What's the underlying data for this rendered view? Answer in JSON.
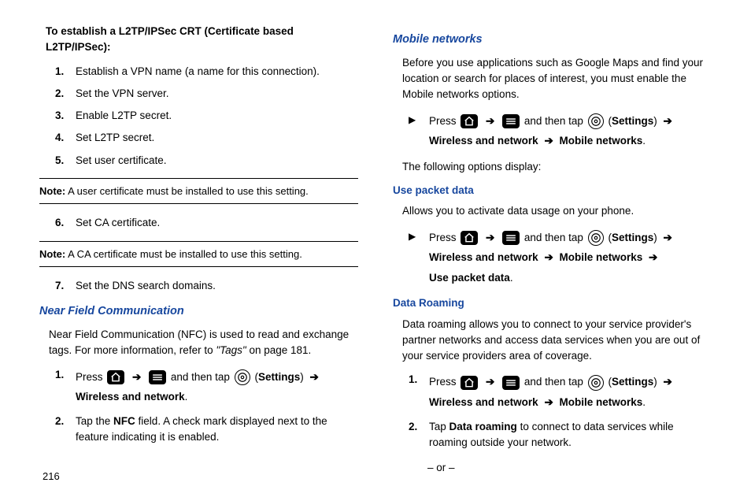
{
  "pageNumber": "216",
  "arrow": "➔",
  "settingsLabel": "Settings",
  "left": {
    "heading": "To establish a L2TP/IPSec CRT (Certificate based L2TP/IPSec):",
    "steps1": [
      "Establish a VPN name (a name for this connection).",
      "Set the VPN server.",
      "Enable L2TP secret.",
      "Set L2TP secret.",
      "Set user certificate."
    ],
    "note1Label": "Note:",
    "note1": " A user certificate must be installed to use this setting.",
    "step6num": "6.",
    "step6": "Set CA certificate.",
    "note2Label": "Note:",
    "note2": " A CA certificate must be installed to use this setting.",
    "step7num": "7.",
    "step7": "Set the DNS search domains.",
    "nfc": {
      "title": "Near Field Communication",
      "intro1": "Near Field Communication (NFC) is used to read and exchange tags. For more information, refer to ",
      "introItal": "\"Tags\"",
      "intro2": "  on page 181.",
      "step1a": "Press ",
      "step1b": " and then tap ",
      "step1c": " (",
      "step1d": ") ",
      "wn": "Wireless and network",
      "period": ".",
      "num1": "1.",
      "num2": "2.",
      "step2a": "Tap the ",
      "step2bold": "NFC",
      "step2b": " field. A check mark displayed next to the feature indicating it is enabled."
    }
  },
  "right": {
    "mn": {
      "title": "Mobile networks",
      "intro": "Before you use applications such as Google Maps and find your location or search for places of interest, you must enable the Mobile networks options.",
      "pressPrefix": "Press ",
      "andThenTap": " and then tap ",
      "openParen": " (",
      "closeParen": ") ",
      "wn": "Wireless and network",
      "mnLabel": "Mobile networks",
      "period": ".",
      "followOpts": "The following options display:"
    },
    "upd": {
      "title": "Use packet data",
      "intro": "Allows you to activate data usage on your phone.",
      "upd": "Use packet data"
    },
    "dr": {
      "title": "Data Roaming",
      "intro": "Data roaming allows you to connect to your service provider's partner networks and access data services when you are out of your service providers area of coverage.",
      "num1": "1.",
      "num2": "2.",
      "step2a": "Tap ",
      "drBold": "Data roaming",
      "step2b": " to connect to data services while roaming outside your network.",
      "or": "– or –"
    }
  }
}
